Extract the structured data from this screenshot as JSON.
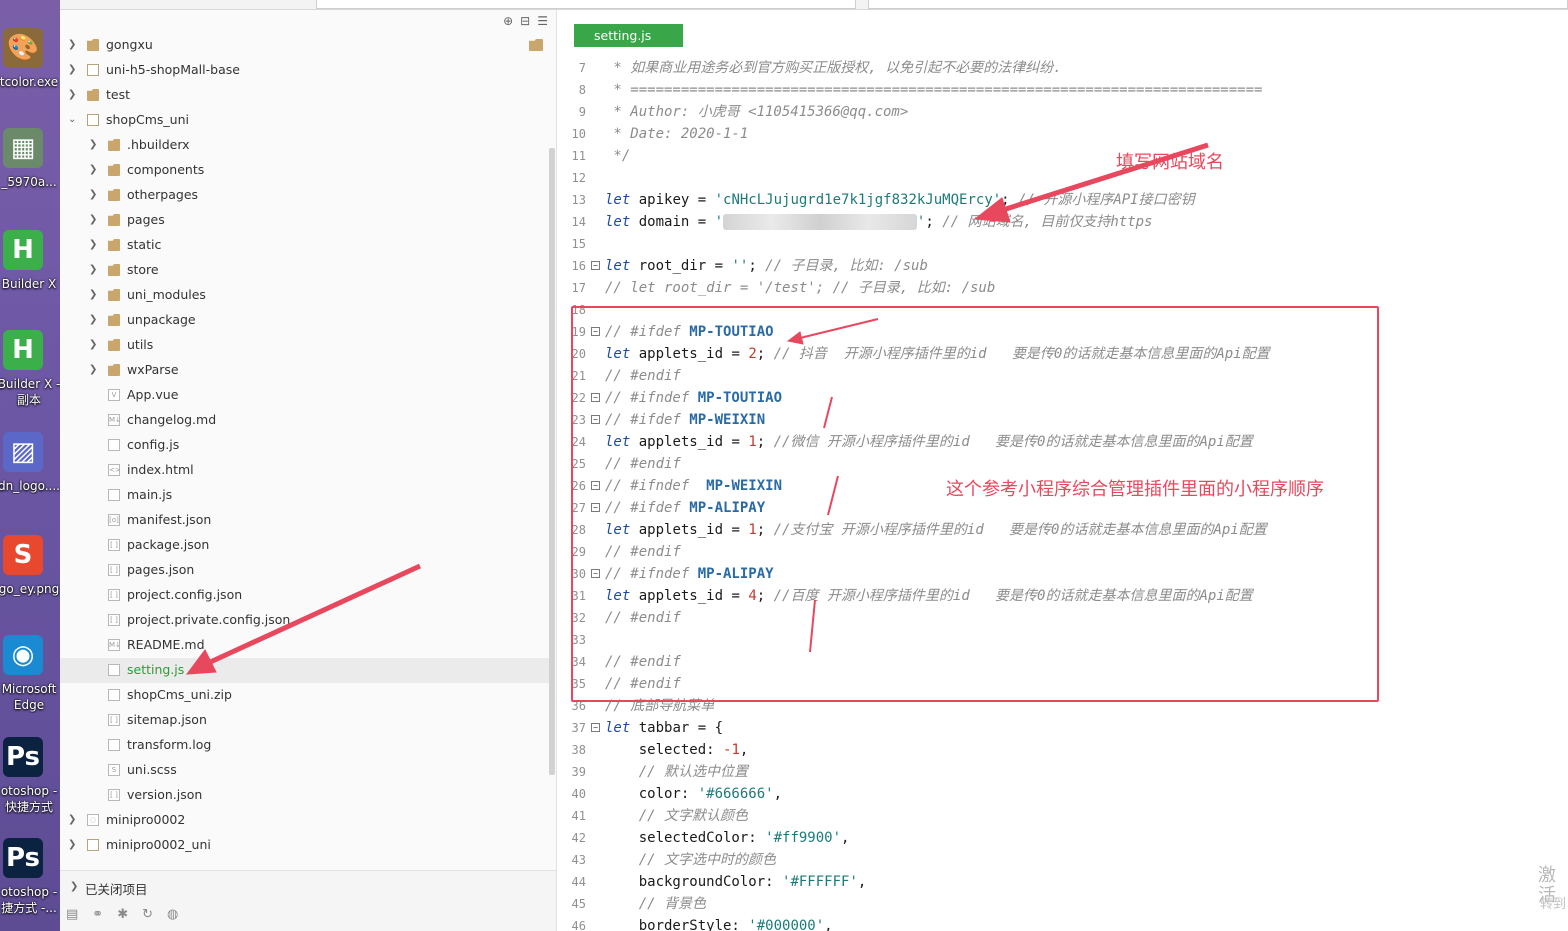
{
  "desktop": {
    "icons": [
      {
        "label": "tcolor.exe",
        "color": "#8a6a3a",
        "glyph": "🎨"
      },
      {
        "label": "_5970a...",
        "color": "#6a8a6a",
        "glyph": "▦"
      },
      {
        "label": "Builder X",
        "color": "#3bb04a",
        "glyph": "H"
      },
      {
        "label": "Builder X -\n副本",
        "color": "#3bb04a",
        "glyph": "H"
      },
      {
        "label": "dn_logo....",
        "color": "#5b68c7",
        "glyph": "▨"
      },
      {
        "label": "go_ey.png",
        "color": "#e8492e",
        "glyph": "S"
      },
      {
        "label": "Microsoft\nEdge",
        "color": "#1a8bd2",
        "glyph": "◉"
      },
      {
        "label": "otoshop -\n快捷方式",
        "color": "#0b2240",
        "glyph": "Ps"
      },
      {
        "label": "otoshop -\n捷方式 -...",
        "color": "#0b2240",
        "glyph": "Ps"
      }
    ]
  },
  "tree": {
    "items": [
      {
        "label": "gongxu",
        "indent": 0,
        "expand": "closed",
        "kind": "folder"
      },
      {
        "label": "uni-h5-shopMall-base",
        "indent": 0,
        "expand": "closed",
        "kind": "project"
      },
      {
        "label": "test",
        "indent": 0,
        "expand": "closed",
        "kind": "folder"
      },
      {
        "label": "shopCms_uni",
        "indent": 0,
        "expand": "open",
        "kind": "project"
      },
      {
        "label": ".hbuilderx",
        "indent": 1,
        "expand": "closed",
        "kind": "folder"
      },
      {
        "label": "components",
        "indent": 1,
        "expand": "closed",
        "kind": "folder"
      },
      {
        "label": "otherpages",
        "indent": 1,
        "expand": "closed",
        "kind": "folder"
      },
      {
        "label": "pages",
        "indent": 1,
        "expand": "closed",
        "kind": "folder"
      },
      {
        "label": "static",
        "indent": 1,
        "expand": "closed",
        "kind": "folder"
      },
      {
        "label": "store",
        "indent": 1,
        "expand": "closed",
        "kind": "folder"
      },
      {
        "label": "uni_modules",
        "indent": 1,
        "expand": "closed",
        "kind": "folder"
      },
      {
        "label": "unpackage",
        "indent": 1,
        "expand": "closed",
        "kind": "folder"
      },
      {
        "label": "utils",
        "indent": 1,
        "expand": "closed",
        "kind": "folder"
      },
      {
        "label": "wxParse",
        "indent": 1,
        "expand": "closed",
        "kind": "folder"
      },
      {
        "label": "App.vue",
        "indent": 1,
        "expand": "none",
        "kind": "vue"
      },
      {
        "label": "changelog.md",
        "indent": 1,
        "expand": "none",
        "kind": "md"
      },
      {
        "label": "config.js",
        "indent": 1,
        "expand": "none",
        "kind": "js"
      },
      {
        "label": "index.html",
        "indent": 1,
        "expand": "none",
        "kind": "html"
      },
      {
        "label": "main.js",
        "indent": 1,
        "expand": "none",
        "kind": "js"
      },
      {
        "label": "manifest.json",
        "indent": 1,
        "expand": "none",
        "kind": "manifest"
      },
      {
        "label": "package.json",
        "indent": 1,
        "expand": "none",
        "kind": "json"
      },
      {
        "label": "pages.json",
        "indent": 1,
        "expand": "none",
        "kind": "json"
      },
      {
        "label": "project.config.json",
        "indent": 1,
        "expand": "none",
        "kind": "json"
      },
      {
        "label": "project.private.config.json",
        "indent": 1,
        "expand": "none",
        "kind": "json"
      },
      {
        "label": "README.md",
        "indent": 1,
        "expand": "none",
        "kind": "md"
      },
      {
        "label": "setting.js",
        "indent": 1,
        "expand": "none",
        "kind": "js",
        "selected": true
      },
      {
        "label": "shopCms_uni.zip",
        "indent": 1,
        "expand": "none",
        "kind": "file"
      },
      {
        "label": "sitemap.json",
        "indent": 1,
        "expand": "none",
        "kind": "json"
      },
      {
        "label": "transform.log",
        "indent": 1,
        "expand": "none",
        "kind": "file"
      },
      {
        "label": "uni.scss",
        "indent": 1,
        "expand": "none",
        "kind": "scss"
      },
      {
        "label": "version.json",
        "indent": 1,
        "expand": "none",
        "kind": "json"
      },
      {
        "label": "minipro0002",
        "indent": 0,
        "expand": "closed",
        "kind": "web"
      },
      {
        "label": "minipro0002_uni",
        "indent": 0,
        "expand": "closed",
        "kind": "project"
      }
    ],
    "closed_projects": "已关闭项目"
  },
  "editor": {
    "tab": "setting.js",
    "lines": [
      {
        "n": "7",
        "fold": "",
        "tokens": [
          [
            "cm",
            " * 如果商业用途务必到官方购买正版授权, 以免引起不必要的法律纠纷."
          ]
        ]
      },
      {
        "n": "8",
        "fold": "",
        "tokens": [
          [
            "cm",
            " * ==========================================================================="
          ]
        ]
      },
      {
        "n": "9",
        "fold": "",
        "tokens": [
          [
            "cm",
            " * Author: 小虎哥 <1105415366@qq.com>"
          ]
        ]
      },
      {
        "n": "10",
        "fold": "",
        "tokens": [
          [
            "cm",
            " * Date: 2020-1-1"
          ]
        ]
      },
      {
        "n": "11",
        "fold": "",
        "tokens": [
          [
            "cm",
            " */"
          ]
        ]
      },
      {
        "n": "12",
        "fold": "",
        "tokens": []
      },
      {
        "n": "13",
        "fold": "",
        "tokens": [
          [
            "kw",
            "let"
          ],
          [
            "id",
            " apikey "
          ],
          [
            "op",
            "= "
          ],
          [
            "str",
            "'cNHcLJujugrd1e7k1jgf832kJuMQErcy'"
          ],
          [
            "op",
            "; "
          ],
          [
            "cm",
            "// 开源小程序API接口密钥"
          ]
        ]
      },
      {
        "n": "14",
        "fold": "",
        "tokens": [
          [
            "kw",
            "let"
          ],
          [
            "id",
            " domain "
          ],
          [
            "op",
            "= "
          ],
          [
            "str",
            "'"
          ],
          [
            "blur",
            "https://xxxxxxxxxxxxxxx"
          ],
          [
            "str",
            "'"
          ],
          [
            "op",
            "; "
          ],
          [
            "cm",
            "// 网站域名, 目前仅支持https"
          ]
        ]
      },
      {
        "n": "15",
        "fold": "",
        "tokens": []
      },
      {
        "n": "16",
        "fold": "−",
        "tokens": [
          [
            "kw",
            "let"
          ],
          [
            "id",
            " root_dir "
          ],
          [
            "op",
            "= "
          ],
          [
            "str",
            "''"
          ],
          [
            "op",
            "; "
          ],
          [
            "cm",
            "// 子目录, 比如: /sub"
          ]
        ]
      },
      {
        "n": "17",
        "fold": "",
        "tokens": [
          [
            "cm",
            "// let root_dir = '/test'; // 子目录, 比如: /sub"
          ]
        ]
      },
      {
        "n": "18",
        "fold": "",
        "tokens": []
      },
      {
        "n": "19",
        "fold": "−",
        "tokens": [
          [
            "cm",
            "// #ifdef "
          ],
          [
            "cmk",
            "MP-TOUTIAO"
          ]
        ]
      },
      {
        "n": "20",
        "fold": "",
        "tokens": [
          [
            "kw",
            "let"
          ],
          [
            "id",
            " applets_id "
          ],
          [
            "op",
            "= "
          ],
          [
            "num",
            "2"
          ],
          [
            "op",
            "; "
          ],
          [
            "cm",
            "// 抖音  开源小程序插件里的id   要是传0的话就走基本信息里面的Api配置"
          ]
        ]
      },
      {
        "n": "21",
        "fold": "",
        "tokens": [
          [
            "cm",
            "// #endif"
          ]
        ]
      },
      {
        "n": "22",
        "fold": "−",
        "tokens": [
          [
            "cm",
            "// #ifndef "
          ],
          [
            "cmk",
            "MP-TOUTIAO"
          ]
        ]
      },
      {
        "n": "23",
        "fold": "−",
        "tokens": [
          [
            "cm",
            "// #ifdef "
          ],
          [
            "cmk",
            "MP-WEIXIN"
          ]
        ]
      },
      {
        "n": "24",
        "fold": "",
        "tokens": [
          [
            "kw",
            "let"
          ],
          [
            "id",
            " applets_id "
          ],
          [
            "op",
            "= "
          ],
          [
            "num",
            "1"
          ],
          [
            "op",
            "; "
          ],
          [
            "cm",
            "//微信 开源小程序插件里的id   要是传0的话就走基本信息里面的Api配置"
          ]
        ]
      },
      {
        "n": "25",
        "fold": "",
        "tokens": [
          [
            "cm",
            "// #endif"
          ]
        ]
      },
      {
        "n": "26",
        "fold": "−",
        "tokens": [
          [
            "cm",
            "// #ifndef  "
          ],
          [
            "cmk",
            "MP-WEIXIN"
          ]
        ]
      },
      {
        "n": "27",
        "fold": "−",
        "tokens": [
          [
            "cm",
            "// #ifdef "
          ],
          [
            "cmk",
            "MP-ALIPAY"
          ]
        ]
      },
      {
        "n": "28",
        "fold": "",
        "tokens": [
          [
            "kw",
            "let"
          ],
          [
            "id",
            " applets_id "
          ],
          [
            "op",
            "= "
          ],
          [
            "num",
            "1"
          ],
          [
            "op",
            "; "
          ],
          [
            "cm",
            "//支付宝 开源小程序插件里的id   要是传0的话就走基本信息里面的Api配置"
          ]
        ]
      },
      {
        "n": "29",
        "fold": "",
        "tokens": [
          [
            "cm",
            "// #endif"
          ]
        ]
      },
      {
        "n": "30",
        "fold": "−",
        "tokens": [
          [
            "cm",
            "// #ifndef "
          ],
          [
            "cmk",
            "MP-ALIPAY"
          ]
        ]
      },
      {
        "n": "31",
        "fold": "",
        "tokens": [
          [
            "kw",
            "let"
          ],
          [
            "id",
            " applets_id "
          ],
          [
            "op",
            "= "
          ],
          [
            "num",
            "4"
          ],
          [
            "op",
            "; "
          ],
          [
            "cm",
            "//百度 开源小程序插件里的id   要是传0的话就走基本信息里面的Api配置"
          ]
        ]
      },
      {
        "n": "32",
        "fold": "",
        "tokens": [
          [
            "cm",
            "// #endif"
          ]
        ]
      },
      {
        "n": "33",
        "fold": "",
        "tokens": []
      },
      {
        "n": "34",
        "fold": "",
        "tokens": [
          [
            "cm",
            "// #endif"
          ]
        ]
      },
      {
        "n": "35",
        "fold": "",
        "tokens": [
          [
            "cm",
            "// #endif"
          ]
        ]
      },
      {
        "n": "36",
        "fold": "",
        "tokens": [
          [
            "cm",
            "// 底部导航菜单"
          ]
        ]
      },
      {
        "n": "37",
        "fold": "−",
        "tokens": [
          [
            "kw",
            "let"
          ],
          [
            "id",
            " tabbar "
          ],
          [
            "op",
            "= {"
          ]
        ]
      },
      {
        "n": "38",
        "fold": "",
        "tokens": [
          [
            "id",
            "    selected: "
          ],
          [
            "num",
            "-1"
          ],
          [
            "op",
            ","
          ]
        ]
      },
      {
        "n": "39",
        "fold": "",
        "tokens": [
          [
            "cm",
            "    // 默认选中位置"
          ]
        ]
      },
      {
        "n": "40",
        "fold": "",
        "tokens": [
          [
            "id",
            "    color: "
          ],
          [
            "str",
            "'#666666'"
          ],
          [
            "op",
            ","
          ]
        ]
      },
      {
        "n": "41",
        "fold": "",
        "tokens": [
          [
            "cm",
            "    // 文字默认颜色"
          ]
        ]
      },
      {
        "n": "42",
        "fold": "",
        "tokens": [
          [
            "id",
            "    selectedColor: "
          ],
          [
            "str",
            "'#ff9900'"
          ],
          [
            "op",
            ","
          ]
        ]
      },
      {
        "n": "43",
        "fold": "",
        "tokens": [
          [
            "cm",
            "    // 文字选中时的颜色"
          ]
        ]
      },
      {
        "n": "44",
        "fold": "",
        "tokens": [
          [
            "id",
            "    backgroundColor: "
          ],
          [
            "str",
            "'#FFFFFF'"
          ],
          [
            "op",
            ","
          ]
        ]
      },
      {
        "n": "45",
        "fold": "",
        "tokens": [
          [
            "cm",
            "    // 背景色"
          ]
        ]
      },
      {
        "n": "46",
        "fold": "",
        "tokens": [
          [
            "id",
            "    borderStyle: "
          ],
          [
            "str",
            "'#000000'"
          ],
          [
            "op",
            ","
          ]
        ]
      }
    ]
  },
  "annotations": {
    "domain_note": "填写网站域名",
    "order_note": "这个参考小程序综合管理插件里面的小程序顺序",
    "accent": "#e8485d"
  },
  "watermark": {
    "line1": "激活",
    "line2": "转到"
  }
}
